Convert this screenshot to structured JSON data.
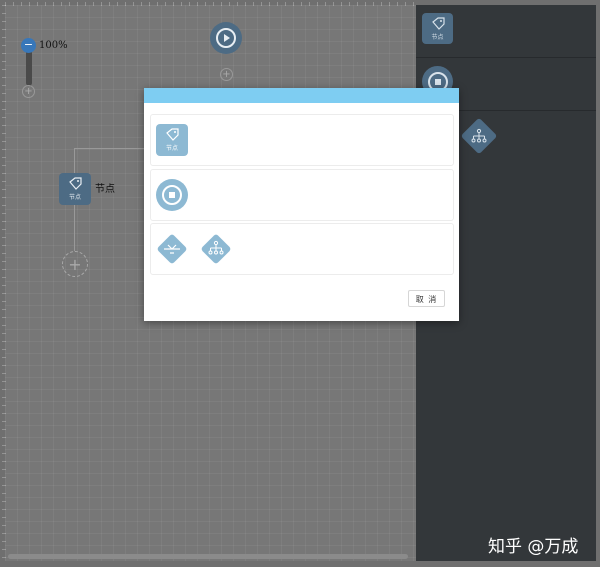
{
  "canvas": {
    "zoom_label": "100%",
    "zoom_minus": "−",
    "zoom_plus": "+",
    "start_plus": "+",
    "node_badge": "节点",
    "node_label": "节点",
    "add_plus": "+"
  },
  "right_panel": {
    "tag_badge": "节点"
  },
  "modal": {
    "tag_badge": "节点",
    "cancel_label": "取 消"
  },
  "colors": {
    "header": "#7ecdf2",
    "icon_light": "#8db9d3",
    "icon_dark": "#4d6b84",
    "panel": "#33373a",
    "zoom_knob": "#3877b9"
  },
  "watermark": "知乎 @万成"
}
